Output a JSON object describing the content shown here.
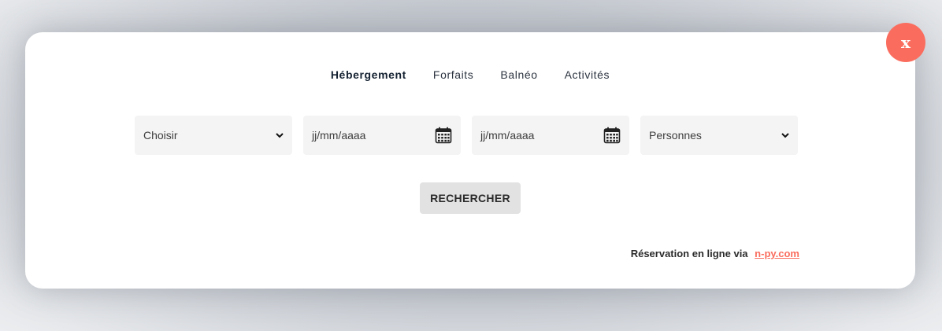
{
  "close": {
    "label": "x"
  },
  "tabs": [
    {
      "label": "Hébergement",
      "active": true
    },
    {
      "label": "Forfaits",
      "active": false
    },
    {
      "label": "Balnéo",
      "active": false
    },
    {
      "label": "Activités",
      "active": false
    }
  ],
  "form": {
    "category": {
      "selected": "Choisir"
    },
    "arrival": {
      "placeholder": "jj/mm/aaaa"
    },
    "departure": {
      "placeholder": "jj/mm/aaaa"
    },
    "persons": {
      "selected": "Personnes"
    },
    "search_label": "RECHERCHER"
  },
  "footer": {
    "text": "Réservation en ligne via",
    "link_text": "n-py.com"
  },
  "colors": {
    "accent": "#fa6d5e",
    "field_bg": "#f4f4f4",
    "button_bg": "#e2e2e2"
  },
  "icons": {
    "close": "close-icon",
    "select_arrow": "chevron-down-icon",
    "date": "calendar-icon"
  }
}
